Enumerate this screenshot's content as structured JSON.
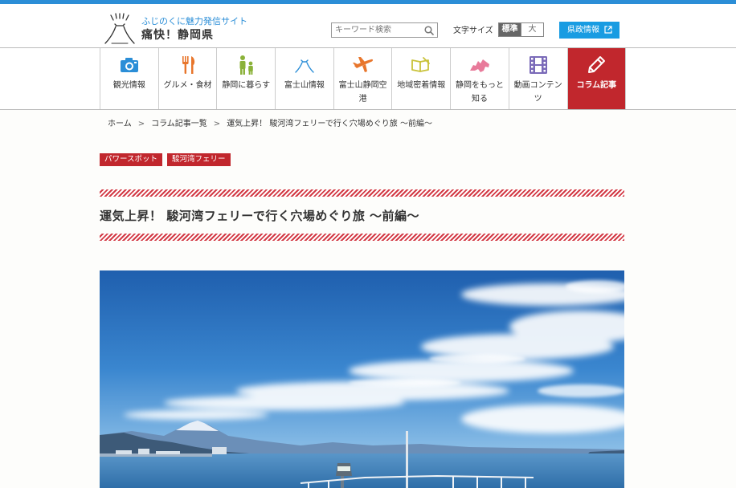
{
  "header": {
    "tagline": "ふじのくに魅力発信サイト",
    "site_name": "痛快！静岡県",
    "search_placeholder": "キーワード検索",
    "font_size_label": "文字サイズ",
    "font_size_standard": "標準",
    "font_size_large": "大",
    "prefecture_button": "県政情報"
  },
  "nav": {
    "items": [
      {
        "label": "観光情報",
        "icon": "camera-icon",
        "color": "#2b8ed7"
      },
      {
        "label": "グルメ・食材",
        "icon": "fork-knife-icon",
        "color": "#e8762c"
      },
      {
        "label": "静岡に暮らす",
        "icon": "family-icon",
        "color": "#8bb23a"
      },
      {
        "label": "富士山情報",
        "icon": "mount-fuji-icon",
        "color": "#2b8ed7"
      },
      {
        "label": "富士山静岡空港",
        "icon": "airplane-icon",
        "color": "#e8762c"
      },
      {
        "label": "地域密着情報",
        "icon": "book-icon",
        "color": "#c9c23a"
      },
      {
        "label": "静岡をもっと知る",
        "icon": "shizuoka-map-icon",
        "color": "#e87a9a"
      },
      {
        "label": "動画コンテンツ",
        "icon": "film-icon",
        "color": "#7a6ab8"
      },
      {
        "label": "コラム記事",
        "icon": "pencil-icon",
        "color": "#ffffff"
      }
    ]
  },
  "breadcrumb": {
    "home": "ホーム",
    "list": "コラム記事一覧",
    "current": "運気上昇！ 駿河湾フェリーで行く穴場めぐり旅 ～前編～",
    "separator": ">"
  },
  "tags": [
    "パワースポット",
    "駿河湾フェリー"
  ],
  "article": {
    "title": "運気上昇！ 駿河湾フェリーで行く穴場めぐり旅 ～前編～"
  },
  "colors": {
    "brand_blue": "#2b8ed7",
    "accent_red": "#c1272d",
    "pref_button": "#189ce2"
  }
}
